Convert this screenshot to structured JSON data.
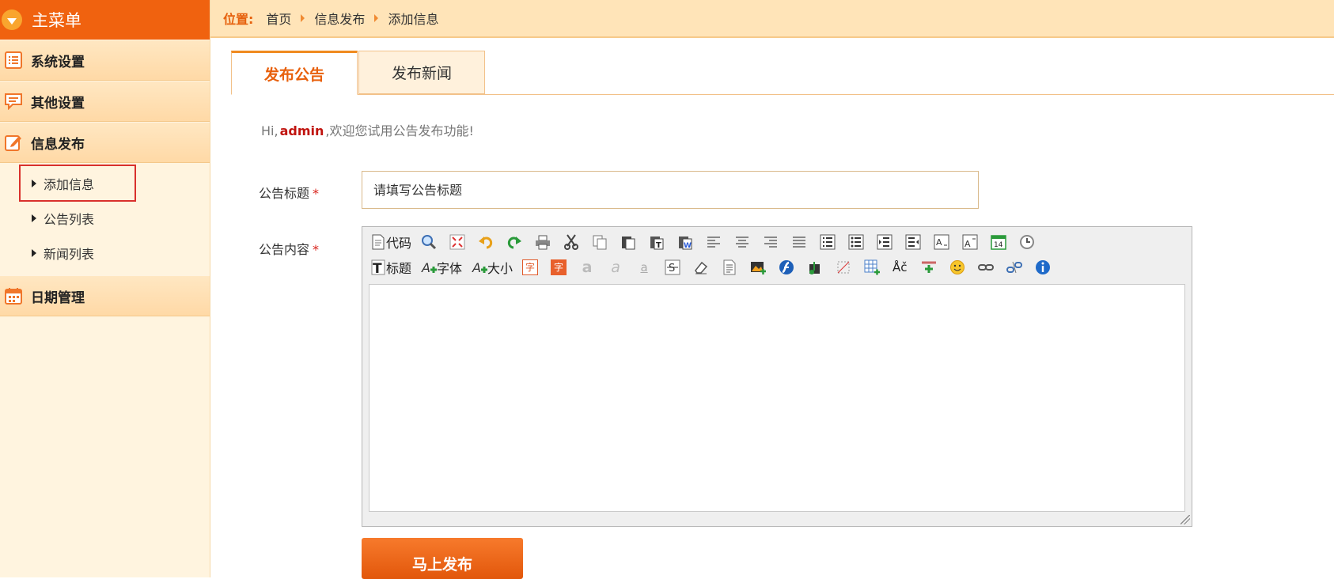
{
  "sidebar": {
    "title": "主菜单",
    "groups": [
      {
        "label": "系统设置",
        "icon": "list-icon"
      },
      {
        "label": "其他设置",
        "icon": "chat-icon"
      },
      {
        "label": "信息发布",
        "icon": "edit-icon"
      }
    ],
    "subitems": [
      {
        "label": "添加信息",
        "active": true
      },
      {
        "label": "公告列表"
      },
      {
        "label": "新闻列表"
      }
    ],
    "last_group": {
      "label": "日期管理",
      "icon": "calendar-icon"
    }
  },
  "breadcrumb": {
    "prefix": "位置:",
    "items": [
      "首页",
      "信息发布",
      "添加信息"
    ]
  },
  "tabs": [
    {
      "label": "发布公告",
      "active": true
    },
    {
      "label": "发布新闻",
      "active": false
    }
  ],
  "welcome": {
    "hi": "Hi,",
    "user": "admin",
    "rest": ",欢迎您试用公告发布功能!"
  },
  "form": {
    "title_label": "公告标题",
    "required_mark": "*",
    "title_placeholder": "请填写公告标题",
    "content_label": "公告内容"
  },
  "editor": {
    "code_label": "代码",
    "heading_label": "标题",
    "font_label": "字体",
    "size_label": "大小",
    "char_label": "字",
    "special_chars": "Åč",
    "calendar_day": "14"
  },
  "publish_button": "马上发布",
  "colors": {
    "accent": "#f0620f",
    "sidebar_bg": "#fff4df",
    "topbar_bg": "#ffe4b8",
    "required": "#d8241c",
    "username": "#c0140f"
  }
}
